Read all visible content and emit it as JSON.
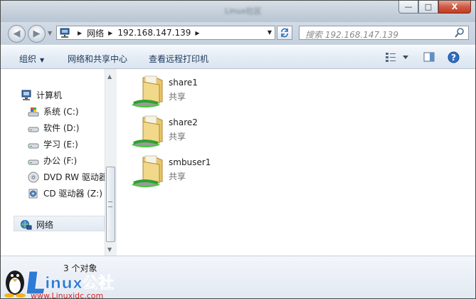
{
  "window": {
    "blurred_title": "Linux社区",
    "caption_buttons": {
      "minimize": "—",
      "maximize": "□",
      "close": "X"
    }
  },
  "address_bar": {
    "crumbs": [
      "网络",
      "192.168.147.139"
    ],
    "search_placeholder": "搜索 192.168.147.139"
  },
  "toolbar": {
    "organize": "组织",
    "network_sharing_center": "网络和共享中心",
    "view_remote_printers": "查看远程打印机"
  },
  "sidebar": {
    "computer": "计算机",
    "drives": [
      {
        "label": "系统 (C:)",
        "icon": "windows-drive-icon"
      },
      {
        "label": "软件 (D:)",
        "icon": "drive-icon"
      },
      {
        "label": "学习 (E:)",
        "icon": "drive-icon"
      },
      {
        "label": "办公 (F:)",
        "icon": "drive-icon"
      },
      {
        "label": "DVD RW 驱动器",
        "icon": "dvd-drive-icon"
      },
      {
        "label": "CD 驱动器 (Z:)",
        "icon": "cd-drive-icon"
      }
    ],
    "network": "网络"
  },
  "shares": [
    {
      "name": "share1",
      "type": "共享"
    },
    {
      "name": "share2",
      "type": "共享"
    },
    {
      "name": "smbuser1",
      "type": "共享"
    }
  ],
  "status": {
    "count": "3 个对象"
  },
  "watermark": {
    "brand": "Linux公社",
    "url": "www.Linuxidc.com"
  }
}
